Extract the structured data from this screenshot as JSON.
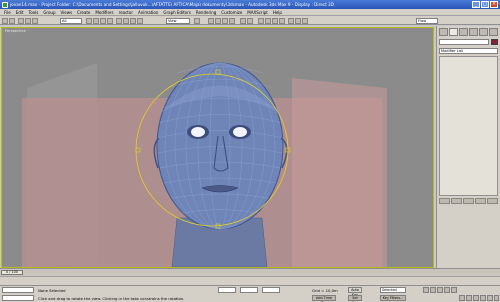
{
  "window": {
    "title": "jovan14.max - Project Folder: C:\\Documents and Settings\\jalluvuk...\\AFTATTE\\ AFTICA\\Maja\\ dokumenty\\3dsmax   -   Autodesk 3ds Max 9   -   Display : Direct 3D"
  },
  "menu": {
    "items": [
      "File",
      "Edit",
      "Tools",
      "Group",
      "Views",
      "Create",
      "Modifiers",
      "reactor",
      "Animation",
      "Graph Editors",
      "Rendering",
      "Customize",
      "MAXScript",
      "Help"
    ]
  },
  "toolbar": {
    "selection_filter": "All",
    "ref_coord": "View",
    "named_selection": "Flow"
  },
  "viewport": {
    "label": "Perspective"
  },
  "command_panel": {
    "modifier_list": "Modifier List"
  },
  "timeline": {
    "slider_label": "0 / 100"
  },
  "status": {
    "selection_info": "None Selected",
    "prompt": "Click and drag to rotate the view.  Clicking in the tabs constrains the rotation.",
    "grid_label": "Grid = 10,0m",
    "auto_key": "Auto Key",
    "set_key": "Set Key",
    "key_mode": "Selected",
    "key_filters": "Key Filters...",
    "add_time_tag": "Add Time Tag"
  },
  "colors": {
    "titlebar": "#2a56b8",
    "viewport_bg": "#8b8b8b",
    "backdrop": "#c49a9a",
    "wireframe": "#6f8fd6",
    "gizmo": "#e8d020",
    "object_color": "#8a1e3a"
  }
}
